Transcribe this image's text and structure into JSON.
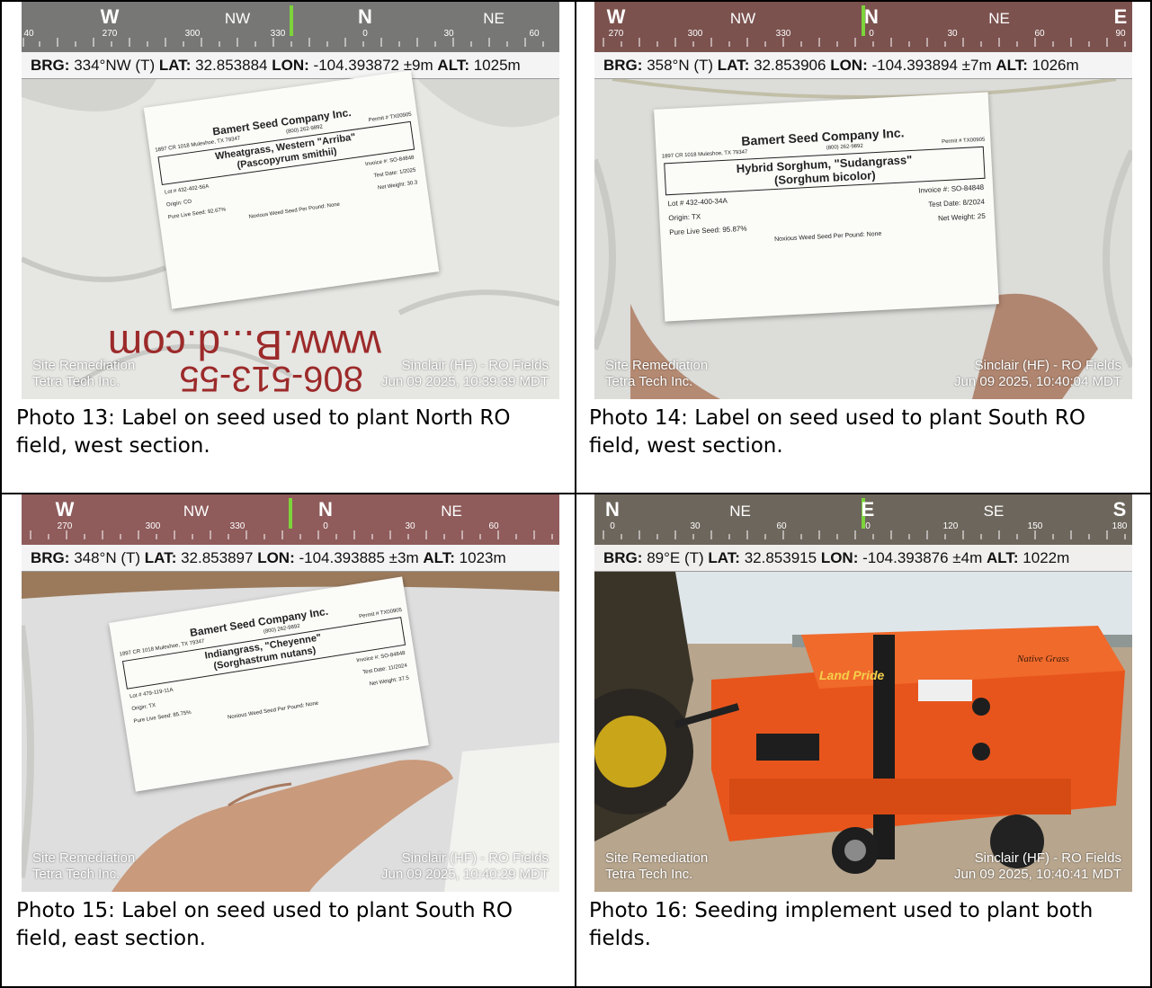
{
  "photos": [
    {
      "compass_labels": [
        {
          "text": "W",
          "big": true
        },
        {
          "text": "270"
        },
        {
          "text": "300"
        },
        {
          "text": "NW"
        },
        {
          "text": "330"
        },
        {
          "text": "N",
          "big": true
        },
        {
          "text": "0"
        },
        {
          "text": "30"
        },
        {
          "text": "NE"
        },
        {
          "text": "60"
        },
        {
          "text": "40"
        }
      ],
      "geo": {
        "brg": "334°NW (T)",
        "lat": "32.853884",
        "lon": "-104.393872 ±9m",
        "alt": "1025m"
      },
      "watermark_left": [
        "Site Remediation",
        "Tetra Tech Inc."
      ],
      "watermark_right": [
        "Sinclair (HF) - RO Fields",
        "Jun 09 2025, 10:39:39 MDT"
      ],
      "label": {
        "company": "Bamert Seed Company Inc.",
        "address": "1897 CR 1018 Muleshoe, TX 79347",
        "phone": "(800) 262-9892",
        "permit": "Permit # TX00905",
        "product": "Wheatgrass, Western \"Arriba\"",
        "species": "(Pascopyrum smithii)",
        "lot": "Lot # 432-402-56A",
        "invoice": "Invoice #: SO-84848",
        "test_date": "Test Date: 1/2025",
        "origin": "Origin: CO",
        "pls": "Pure Live Seed: 92.67%",
        "net_weight": "Net Weight: 30.3",
        "noxious": "Noxious Weed Seed Per Pound: None"
      },
      "caption": "Photo 13: Label on seed used to plant North RO field, west section."
    },
    {
      "compass_labels": [
        {
          "text": "W",
          "big": true
        },
        {
          "text": "270"
        },
        {
          "text": "300"
        },
        {
          "text": "NW"
        },
        {
          "text": "330"
        },
        {
          "text": "N",
          "big": true
        },
        {
          "text": "0"
        },
        {
          "text": "30"
        },
        {
          "text": "NE"
        },
        {
          "text": "60"
        },
        {
          "text": "E",
          "big": true
        },
        {
          "text": "90"
        }
      ],
      "geo": {
        "brg": "358°N (T)",
        "lat": "32.853906",
        "lon": "-104.393894 ±7m",
        "alt": "1026m"
      },
      "watermark_left": [
        "Site Remediation",
        "Tetra Tech Inc."
      ],
      "watermark_right": [
        "Sinclair (HF) - RO Fields",
        "Jun 09 2025, 10:40:04 MDT"
      ],
      "label": {
        "company": "Bamert Seed Company Inc.",
        "address": "1897 CR 1018 Muleshoe, TX 79347",
        "phone": "(800) 262-9892",
        "permit": "Permit # TX00905",
        "product": "Hybrid Sorghum, \"Sudangrass\"",
        "species": "(Sorghum bicolor)",
        "lot": "Lot # 432-400-34A",
        "invoice": "Invoice #: SO-84848",
        "test_date": "Test Date: 8/2024",
        "origin": "Origin: TX",
        "pls": "Pure Live Seed: 95.87%",
        "net_weight": "Net Weight: 25",
        "noxious": "Noxious Weed Seed Per Pound: None"
      },
      "caption": "Photo 14: Label on seed used to plant South RO field, west section."
    },
    {
      "compass_labels": [
        {
          "text": "W",
          "big": true
        },
        {
          "text": "270"
        },
        {
          "text": "300"
        },
        {
          "text": "NW"
        },
        {
          "text": "330"
        },
        {
          "text": "N",
          "big": true
        },
        {
          "text": "0"
        },
        {
          "text": "30"
        },
        {
          "text": "NE"
        },
        {
          "text": "60"
        }
      ],
      "geo": {
        "brg": "348°N (T)",
        "lat": "32.853897",
        "lon": "-104.393885 ±3m",
        "alt": "1023m"
      },
      "watermark_left": [
        "Site Remediation",
        "Tetra Tech Inc."
      ],
      "watermark_right": [
        "Sinclair (HF) - RO Fields",
        "Jun 09 2025, 10:40:29 MDT"
      ],
      "label": {
        "company": "Bamert Seed Company Inc.",
        "address": "1897 CR 1018 Muleshoe, TX 79347",
        "phone": "(800) 262-9892",
        "permit": "Permit # TX00905",
        "product": "Indiangrass, \"Cheyenne\"",
        "species": "(Sorghastrum nutans)",
        "lot": "Lot # 479-119-11A",
        "invoice": "Invoice #: SO-84848",
        "test_date": "Test Date: 11/2024",
        "origin": "Origin: TX",
        "pls": "Pure Live Seed: 85.75%",
        "net_weight": "Net Weight: 37.5",
        "noxious": "Noxious Weed Seed Per Pound: None"
      },
      "caption": "Photo 15: Label on seed used to plant South RO field, east section."
    },
    {
      "compass_labels": [
        {
          "text": "N",
          "big": true
        },
        {
          "text": "0"
        },
        {
          "text": "30"
        },
        {
          "text": "NE"
        },
        {
          "text": "60"
        },
        {
          "text": "E",
          "big": true
        },
        {
          "text": "0"
        },
        {
          "text": "120"
        },
        {
          "text": "SE"
        },
        {
          "text": "150"
        },
        {
          "text": "S",
          "big": true
        },
        {
          "text": "180"
        }
      ],
      "geo": {
        "brg": "89°E (T)",
        "lat": "32.853915",
        "lon": "-104.393876 ±4m",
        "alt": "1022m"
      },
      "watermark_left": [
        "Site Remediation",
        "Tetra Tech Inc."
      ],
      "watermark_right": [
        "Sinclair (HF) - RO Fields",
        "Jun 09 2025, 10:40:41 MDT"
      ],
      "implement": {
        "brand": "Land Pride",
        "decal": "Native Grass"
      },
      "caption": "Photo 16: Seeding implement used to plant both fields."
    }
  ],
  "colors": {
    "compass_bg": "#3a3a3a",
    "heading_marker": "#7cd43a",
    "implement_orange": "#e8551c",
    "bag_white": "#e9e9e6",
    "gravel": "#b7a58d",
    "sky": "#dfe6ea"
  }
}
